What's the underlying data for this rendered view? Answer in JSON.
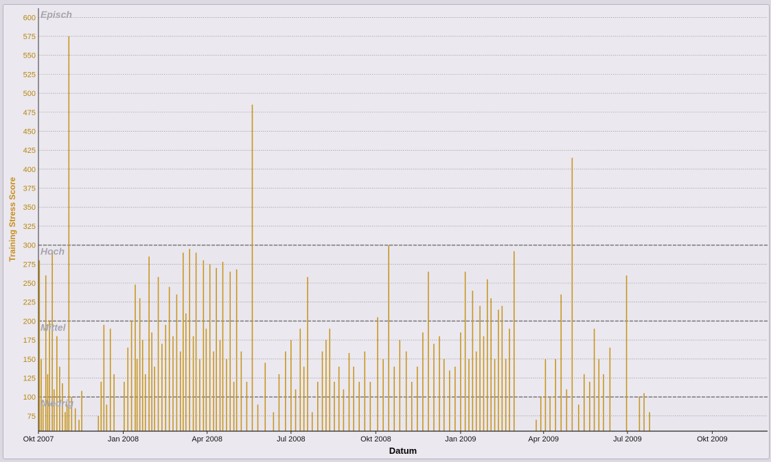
{
  "chart_data": {
    "type": "bar",
    "title": "",
    "xlabel": "Datum",
    "ylabel": "Training Stress Score",
    "ylim": [
      55,
      612
    ],
    "yticks": [
      75,
      100,
      125,
      150,
      175,
      200,
      225,
      250,
      275,
      300,
      325,
      350,
      375,
      400,
      425,
      450,
      475,
      500,
      525,
      550,
      575,
      600
    ],
    "xlim": [
      "2007-10-01",
      "2009-11-30"
    ],
    "xticks": [
      {
        "date": "2007-10-01",
        "label": "Okt 2007"
      },
      {
        "date": "2008-01-01",
        "label": "Jan 2008"
      },
      {
        "date": "2008-04-01",
        "label": "Apr 2008"
      },
      {
        "date": "2008-07-01",
        "label": "Jul 2008"
      },
      {
        "date": "2008-10-01",
        "label": "Okt 2008"
      },
      {
        "date": "2009-01-01",
        "label": "Jan 2009"
      },
      {
        "date": "2009-04-01",
        "label": "Apr 2009"
      },
      {
        "date": "2009-07-01",
        "label": "Jul 2009"
      },
      {
        "date": "2009-10-01",
        "label": "Okt 2009"
      }
    ],
    "grid": true,
    "bar_color": "#c8961e",
    "zones": [
      {
        "label": "Episch",
        "from": 300,
        "to": 612
      },
      {
        "label": "Hoch",
        "from": 200,
        "to": 300
      },
      {
        "label": "Mittel",
        "from": 100,
        "to": 200
      },
      {
        "label": "Niedrig",
        "from": 55,
        "to": 100
      }
    ],
    "zone_thresholds": [
      100,
      200,
      300
    ],
    "series": [
      {
        "values": [
          [
            "2007-10-02",
            280
          ],
          [
            "2007-10-04",
            150
          ],
          [
            "2007-10-06",
            90
          ],
          [
            "2007-10-09",
            260
          ],
          [
            "2007-10-11",
            130
          ],
          [
            "2007-10-13",
            200
          ],
          [
            "2007-10-16",
            290
          ],
          [
            "2007-10-18",
            110
          ],
          [
            "2007-10-21",
            180
          ],
          [
            "2007-10-24",
            140
          ],
          [
            "2007-10-27",
            118
          ],
          [
            "2007-10-30",
            80
          ],
          [
            "2007-11-01",
            90
          ],
          [
            "2007-11-03",
            575
          ],
          [
            "2007-11-06",
            100
          ],
          [
            "2007-11-10",
            85
          ],
          [
            "2007-11-14",
            70
          ],
          [
            "2007-11-17",
            108
          ],
          [
            "2007-12-05",
            75
          ],
          [
            "2007-12-08",
            120
          ],
          [
            "2007-12-11",
            195
          ],
          [
            "2007-12-14",
            90
          ],
          [
            "2007-12-18",
            190
          ],
          [
            "2007-12-22",
            130
          ],
          [
            "2008-01-02",
            120
          ],
          [
            "2008-01-06",
            165
          ],
          [
            "2008-01-10",
            200
          ],
          [
            "2008-01-14",
            248
          ],
          [
            "2008-01-16",
            150
          ],
          [
            "2008-01-19",
            230
          ],
          [
            "2008-01-22",
            175
          ],
          [
            "2008-01-25",
            130
          ],
          [
            "2008-01-29",
            285
          ],
          [
            "2008-02-01",
            185
          ],
          [
            "2008-02-04",
            140
          ],
          [
            "2008-02-08",
            258
          ],
          [
            "2008-02-12",
            170
          ],
          [
            "2008-02-16",
            195
          ],
          [
            "2008-02-20",
            245
          ],
          [
            "2008-02-24",
            180
          ],
          [
            "2008-02-28",
            235
          ],
          [
            "2008-03-03",
            160
          ],
          [
            "2008-03-06",
            290
          ],
          [
            "2008-03-09",
            210
          ],
          [
            "2008-03-13",
            295
          ],
          [
            "2008-03-17",
            180
          ],
          [
            "2008-03-20",
            290
          ],
          [
            "2008-03-24",
            150
          ],
          [
            "2008-03-28",
            280
          ],
          [
            "2008-03-31",
            190
          ],
          [
            "2008-04-04",
            275
          ],
          [
            "2008-04-08",
            160
          ],
          [
            "2008-04-11",
            270
          ],
          [
            "2008-04-15",
            175
          ],
          [
            "2008-04-18",
            278
          ],
          [
            "2008-04-22",
            150
          ],
          [
            "2008-04-26",
            265
          ],
          [
            "2008-04-30",
            120
          ],
          [
            "2008-05-03",
            268
          ],
          [
            "2008-05-08",
            160
          ],
          [
            "2008-05-14",
            120
          ],
          [
            "2008-05-20",
            485
          ],
          [
            "2008-05-26",
            90
          ],
          [
            "2008-06-03",
            145
          ],
          [
            "2008-06-12",
            80
          ],
          [
            "2008-06-18",
            130
          ],
          [
            "2008-06-25",
            160
          ],
          [
            "2008-07-01",
            175
          ],
          [
            "2008-07-06",
            110
          ],
          [
            "2008-07-11",
            190
          ],
          [
            "2008-07-15",
            140
          ],
          [
            "2008-07-19",
            258
          ],
          [
            "2008-07-24",
            80
          ],
          [
            "2008-07-30",
            120
          ],
          [
            "2008-08-04",
            160
          ],
          [
            "2008-08-08",
            175
          ],
          [
            "2008-08-12",
            190
          ],
          [
            "2008-08-17",
            120
          ],
          [
            "2008-08-22",
            140
          ],
          [
            "2008-08-27",
            110
          ],
          [
            "2008-09-02",
            158
          ],
          [
            "2008-09-07",
            140
          ],
          [
            "2008-09-13",
            120
          ],
          [
            "2008-09-19",
            160
          ],
          [
            "2008-09-25",
            120
          ],
          [
            "2008-10-03",
            205
          ],
          [
            "2008-10-09",
            150
          ],
          [
            "2008-10-15",
            300
          ],
          [
            "2008-10-21",
            140
          ],
          [
            "2008-10-27",
            175
          ],
          [
            "2008-11-03",
            160
          ],
          [
            "2008-11-09",
            120
          ],
          [
            "2008-11-15",
            140
          ],
          [
            "2008-11-21",
            185
          ],
          [
            "2008-11-27",
            265
          ],
          [
            "2008-12-03",
            170
          ],
          [
            "2008-12-09",
            180
          ],
          [
            "2008-12-14",
            150
          ],
          [
            "2008-12-20",
            135
          ],
          [
            "2008-12-26",
            140
          ],
          [
            "2009-01-01",
            185
          ],
          [
            "2009-01-06",
            265
          ],
          [
            "2009-01-10",
            150
          ],
          [
            "2009-01-14",
            240
          ],
          [
            "2009-01-18",
            160
          ],
          [
            "2009-01-22",
            220
          ],
          [
            "2009-01-26",
            180
          ],
          [
            "2009-01-30",
            255
          ],
          [
            "2009-02-03",
            230
          ],
          [
            "2009-02-07",
            150
          ],
          [
            "2009-02-11",
            215
          ],
          [
            "2009-02-15",
            220
          ],
          [
            "2009-02-19",
            150
          ],
          [
            "2009-02-23",
            190
          ],
          [
            "2009-02-28",
            292
          ],
          [
            "2009-03-24",
            70
          ],
          [
            "2009-03-29",
            100
          ],
          [
            "2009-04-03",
            150
          ],
          [
            "2009-04-08",
            100
          ],
          [
            "2009-04-14",
            150
          ],
          [
            "2009-04-20",
            235
          ],
          [
            "2009-04-26",
            110
          ],
          [
            "2009-05-02",
            415
          ],
          [
            "2009-05-09",
            90
          ],
          [
            "2009-05-15",
            130
          ],
          [
            "2009-05-21",
            120
          ],
          [
            "2009-05-26",
            190
          ],
          [
            "2009-05-31",
            150
          ],
          [
            "2009-06-05",
            130
          ],
          [
            "2009-06-12",
            165
          ],
          [
            "2009-06-30",
            260
          ],
          [
            "2009-07-14",
            100
          ],
          [
            "2009-07-19",
            105
          ],
          [
            "2009-07-25",
            80
          ]
        ]
      }
    ]
  }
}
